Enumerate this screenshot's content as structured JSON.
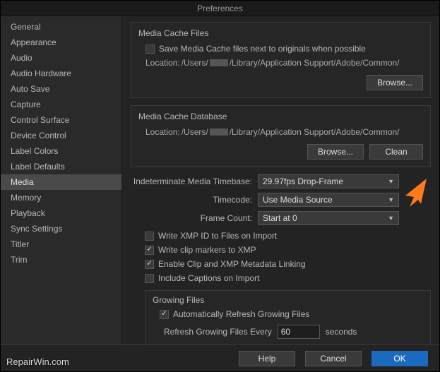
{
  "window": {
    "title": "Preferences"
  },
  "sidebar": {
    "items": [
      {
        "label": "General"
      },
      {
        "label": "Appearance"
      },
      {
        "label": "Audio"
      },
      {
        "label": "Audio Hardware"
      },
      {
        "label": "Auto Save"
      },
      {
        "label": "Capture"
      },
      {
        "label": "Control Surface"
      },
      {
        "label": "Device Control"
      },
      {
        "label": "Label Colors"
      },
      {
        "label": "Label Defaults"
      },
      {
        "label": "Media",
        "selected": true
      },
      {
        "label": "Memory"
      },
      {
        "label": "Playback"
      },
      {
        "label": "Sync Settings"
      },
      {
        "label": "Titler"
      },
      {
        "label": "Trim"
      }
    ]
  },
  "cache_files": {
    "title": "Media Cache Files",
    "save_next_to_originals": {
      "label": "Save Media Cache files next to originals when possible",
      "checked": false
    },
    "location_label": "Location:",
    "location_pre": "/Users/",
    "location_post": "/Library/Application Support/Adobe/Common/",
    "browse": "Browse..."
  },
  "cache_db": {
    "title": "Media Cache Database",
    "location_label": "Location:",
    "location_pre": "/Users/",
    "location_post": "/Library/Application Support/Adobe/Common/",
    "browse": "Browse...",
    "clean": "Clean"
  },
  "timebase": {
    "label": "Indeterminate Media Timebase:",
    "value": "29.97fps Drop-Frame"
  },
  "timecode": {
    "label": "Timecode:",
    "value": "Use Media Source"
  },
  "frame_count": {
    "label": "Frame Count:",
    "value": "Start at 0"
  },
  "options": {
    "write_xmp_id": {
      "label": "Write XMP ID to Files on Import",
      "checked": false
    },
    "write_clip_markers": {
      "label": "Write clip markers to XMP",
      "checked": true
    },
    "enable_clip_xmp": {
      "label": "Enable Clip and XMP Metadata Linking",
      "checked": true
    },
    "include_captions": {
      "label": "Include Captions on Import",
      "checked": false
    }
  },
  "growing": {
    "title": "Growing Files",
    "auto_refresh": {
      "label": "Automatically Refresh Growing Files",
      "checked": true
    },
    "refresh_label": "Refresh Growing Files Every",
    "refresh_value": "60",
    "refresh_unit": "seconds"
  },
  "footer": {
    "help": "Help",
    "cancel": "Cancel",
    "ok": "OK"
  },
  "watermark": "RepairWin.com"
}
